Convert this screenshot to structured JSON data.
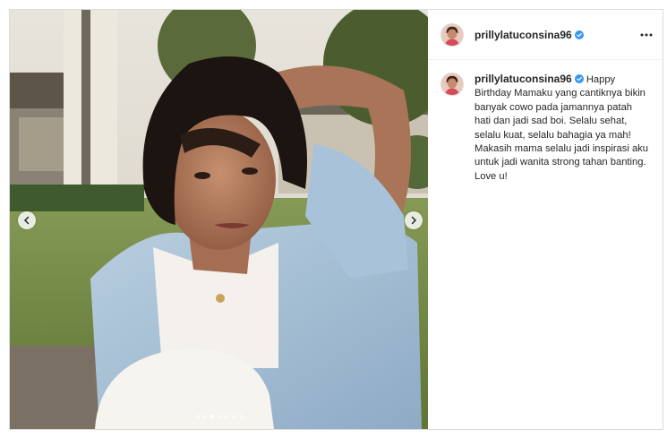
{
  "post": {
    "author": {
      "username": "prillylatuconsina96",
      "verified": true,
      "avatar_icon": "profile-avatar"
    },
    "more_icon": "more-options-icon",
    "caption": "Happy Birthday Mamaku yang cantiknya bikin banyak cowo pada jamannya patah hati dan jadi sad boi. Selalu sehat, selalu kuat, selalu bahagia ya mah! Makasih mama selalu jadi inspirasi aku untuk jadi wanita strong tahan banting. Love u!",
    "carousel": {
      "total": 7,
      "active_index": 2,
      "prev_icon": "chevron-left-icon",
      "next_icon": "chevron-right-icon"
    }
  },
  "colors": {
    "verified": "#3897f0",
    "border": "#dbdbdb",
    "text": "#262626"
  }
}
